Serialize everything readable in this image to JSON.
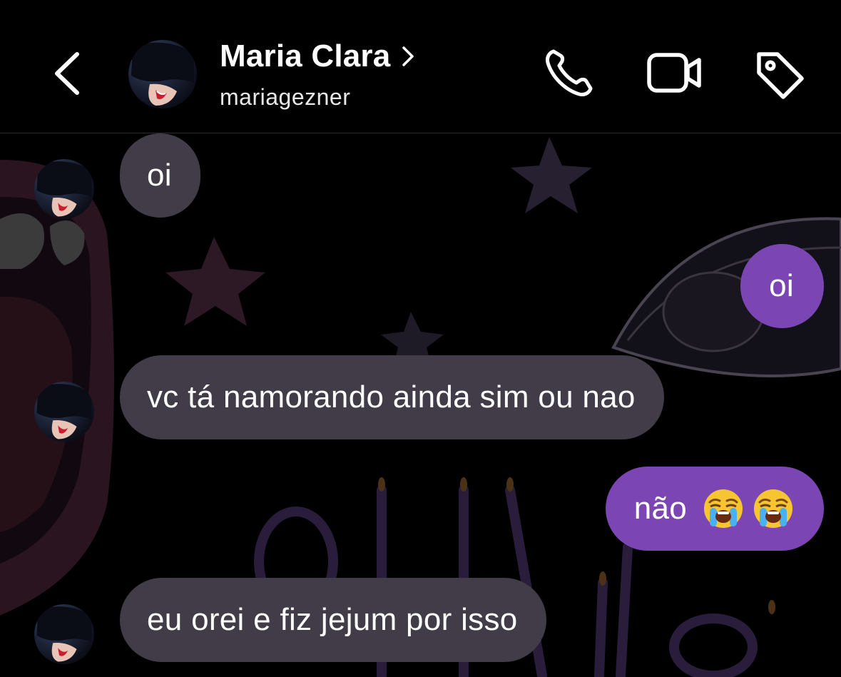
{
  "header": {
    "contact_name": "Maria Clara",
    "username": "mariagezner",
    "icons": [
      "back-chevron-icon",
      "chevron-right-icon",
      "phone-icon",
      "video-camera-icon",
      "tag-icon"
    ]
  },
  "messages": [
    {
      "direction": "incoming",
      "text": "oi"
    },
    {
      "direction": "outgoing",
      "text": "oi"
    },
    {
      "direction": "incoming",
      "text": "vc tá namorando ainda sim ou nao"
    },
    {
      "direction": "outgoing",
      "text": "não",
      "emojis": [
        "loudly-crying-face",
        "loudly-crying-face"
      ]
    },
    {
      "direction": "incoming",
      "text": "eu orei e fiz jejum por isso"
    }
  ],
  "colors": {
    "background": "#000000",
    "incoming_bubble": "#413c47",
    "outgoing_bubble": "#7b46b3",
    "text": "#ffffff"
  }
}
